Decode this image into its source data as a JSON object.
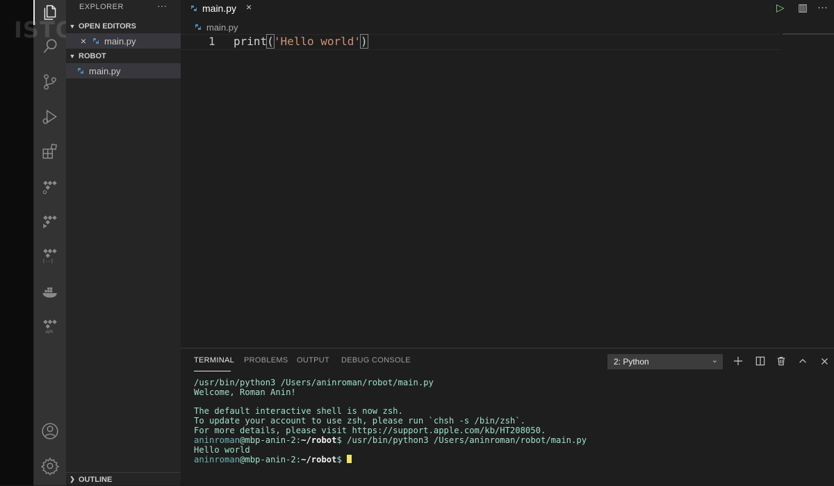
{
  "watermark": "ISTORIES",
  "activity_bar": {
    "icons": [
      "files-icon",
      "search-icon",
      "source-control-icon",
      "run-debug-icon",
      "extensions-icon",
      "remote-icon",
      "test-icon",
      "json-icon",
      "docker-icon",
      "api-icon"
    ],
    "bottom_icons": [
      "account-icon",
      "settings-gear-icon"
    ]
  },
  "sidebar": {
    "title": "EXPLORER",
    "more": "···",
    "open_editors": {
      "label": "OPEN EDITORS",
      "items": [
        {
          "label": "main.py",
          "close": "×"
        }
      ]
    },
    "folder": {
      "label": "ROBOT",
      "items": [
        {
          "label": "main.py"
        }
      ]
    },
    "outline": {
      "label": "OUTLINE"
    }
  },
  "editor": {
    "tab": {
      "label": "main.py",
      "close": "×"
    },
    "breadcrumb": "main.py",
    "line_number": "1",
    "code": {
      "fn": "print",
      "open": "(",
      "str": "'Hello world'",
      "close": ")"
    },
    "toolbar": {
      "run": "▷",
      "split": "▥",
      "more": "···"
    }
  },
  "panel": {
    "tabs": [
      "TERMINAL",
      "PROBLEMS",
      "OUTPUT",
      "DEBUG CONSOLE"
    ],
    "active_tab": "TERMINAL",
    "terminal_select": "2: Python",
    "icons": [
      "plus-icon",
      "split-terminal-icon",
      "trash-icon",
      "chevron-up-icon",
      "close-icon"
    ]
  },
  "terminal": {
    "lines": [
      "/usr/bin/python3 /Users/aninroman/robot/main.py",
      "Welcome, Roman Anin!",
      "",
      "The default interactive shell is now zsh.",
      "To update your account to use zsh, please run `chsh -s /bin/zsh`.",
      "For more details, please visit https://support.apple.com/kb/HT208050."
    ],
    "prompt_user": "aninroman",
    "prompt_host": "@mbp-anin-2:",
    "prompt_path": "~/robot",
    "prompt_sym": "$",
    "cmd": " /usr/bin/python3 /Users/aninroman/robot/main.py",
    "output": "Hello world"
  },
  "colors": {
    "accent": "#0e639c",
    "string": "#ce9178",
    "terminal_text": "#9fe0c9"
  }
}
